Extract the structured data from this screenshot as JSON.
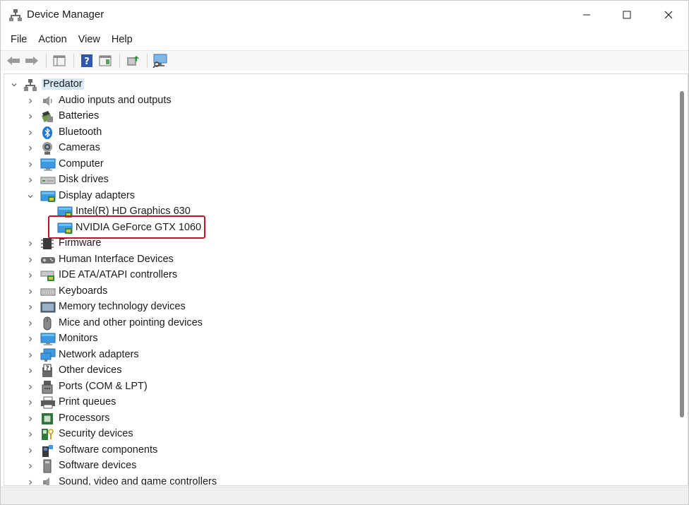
{
  "window": {
    "title": "Device Manager",
    "icon": "device-manager-icon"
  },
  "menu": [
    "File",
    "Action",
    "View",
    "Help"
  ],
  "toolbar": {
    "buttons": [
      "back-arrow-icon",
      "forward-arrow-icon",
      "show-hide-tree-icon",
      "help-icon",
      "properties-pane-icon",
      "update-driver-icon",
      "scan-hardware-icon"
    ]
  },
  "tree": {
    "root": "Predator",
    "items": [
      {
        "label": "Audio inputs and outputs",
        "icon": "speaker-icon"
      },
      {
        "label": "Batteries",
        "icon": "battery-icon"
      },
      {
        "label": "Bluetooth",
        "icon": "bluetooth-icon"
      },
      {
        "label": "Cameras",
        "icon": "camera-icon"
      },
      {
        "label": "Computer",
        "icon": "computer-icon"
      },
      {
        "label": "Disk drives",
        "icon": "disk-drive-icon"
      },
      {
        "label": "Display adapters",
        "icon": "display-adapter-icon",
        "expanded": true,
        "children": [
          "Intel(R) HD Graphics 630",
          "NVIDIA GeForce GTX 1060"
        ]
      },
      {
        "label": "Firmware",
        "icon": "firmware-icon"
      },
      {
        "label": "Human Interface Devices",
        "icon": "hid-icon"
      },
      {
        "label": "IDE ATA/ATAPI controllers",
        "icon": "ide-controller-icon"
      },
      {
        "label": "Keyboards",
        "icon": "keyboard-icon"
      },
      {
        "label": "Memory technology devices",
        "icon": "memory-icon"
      },
      {
        "label": "Mice and other pointing devices",
        "icon": "mouse-icon"
      },
      {
        "label": "Monitors",
        "icon": "monitor-icon"
      },
      {
        "label": "Network adapters",
        "icon": "network-adapter-icon"
      },
      {
        "label": "Other devices",
        "icon": "other-devices-icon"
      },
      {
        "label": "Ports (COM & LPT)",
        "icon": "port-icon"
      },
      {
        "label": "Print queues",
        "icon": "printer-icon"
      },
      {
        "label": "Processors",
        "icon": "processor-icon"
      },
      {
        "label": "Security devices",
        "icon": "security-device-icon"
      },
      {
        "label": "Software components",
        "icon": "software-component-icon"
      },
      {
        "label": "Software devices",
        "icon": "software-device-icon"
      },
      {
        "label": "Sound, video and game controllers",
        "icon": "sound-controller-icon"
      }
    ]
  },
  "colors": {
    "highlight": "#c8102e",
    "accent": "#1e90d6"
  }
}
